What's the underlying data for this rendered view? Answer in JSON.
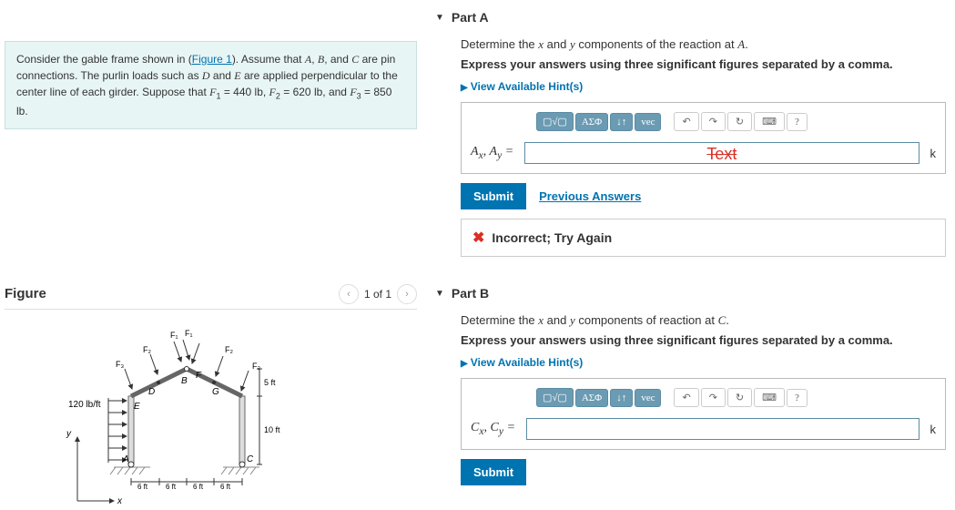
{
  "problem": {
    "text_prefix": "Consider the gable frame shown in (",
    "figure_link": "Figure 1",
    "text_mid": "). Assume that ",
    "vars_abc": "A, B, and C",
    "text_pin": " are pin connections. The purlin loads such as ",
    "vars_de": "D and E",
    "text_perp": " are applied perpendicular to the center line of each girder. Suppose that ",
    "f1": "F₁ = 440 lb",
    "f2": "F₂ = 620 lb",
    "f3": "F₃ = 850 lb",
    "text_end": "."
  },
  "figure": {
    "title": "Figure",
    "pager": "1 of 1"
  },
  "diagram": {
    "dist_load": "120 lb/ft",
    "h1": "5 ft",
    "h2": "10 ft",
    "seg": "6 ft",
    "points": {
      "A": "A",
      "B": "B",
      "C": "C",
      "D": "D",
      "E": "E",
      "F": "F",
      "G": "G"
    },
    "forces": {
      "F1": "F₁",
      "F2": "F₂",
      "F3": "F₃"
    },
    "axes": {
      "x": "x",
      "y": "y"
    }
  },
  "partA": {
    "header": "Part A",
    "question_pre": "Determine the ",
    "question_x": "x",
    "question_mid": " and ",
    "question_y": "y",
    "question_post": " components of the reaction at ",
    "question_point": "A",
    "question_end": ".",
    "instruction": "Express your answers using three significant figures separated by a comma.",
    "hints": "View Available Hint(s)",
    "var_label": "Aₓ, Aᵧ =",
    "input_value": "Text",
    "unit": "k",
    "submit": "Submit",
    "prev": "Previous Answers",
    "feedback": "Incorrect; Try Again"
  },
  "partB": {
    "header": "Part B",
    "question_pre": "Determine the ",
    "question_x": "x",
    "question_mid": " and ",
    "question_y": "y",
    "question_post": " components of reaction at ",
    "question_point": "C",
    "question_end": ".",
    "instruction": "Express your answers using three significant figures separated by a comma.",
    "hints": "View Available Hint(s)",
    "var_label": "Cₓ, Cᵧ =",
    "unit": "k",
    "submit": "Submit"
  },
  "toolbar": {
    "templates": "▢√▢",
    "greek": "ΑΣΦ",
    "subscript": "↓↑",
    "vec": "vec",
    "undo": "↶",
    "redo": "↷",
    "reset": "↻",
    "keyboard": "⌨",
    "help": "?"
  }
}
